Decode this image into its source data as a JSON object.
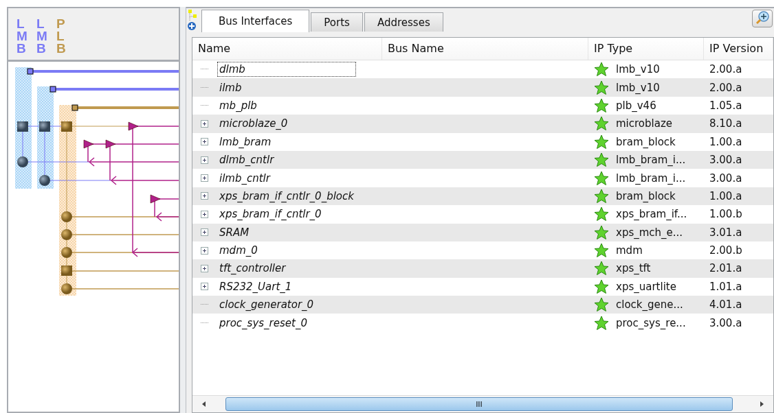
{
  "bus_panel": {
    "buses": [
      {
        "label": "LMB",
        "color": "#7b7bf5"
      },
      {
        "label": "LMB",
        "color": "#7b7bf5"
      },
      {
        "label": "PLB",
        "color": "#c09a50"
      }
    ]
  },
  "tabs": [
    {
      "label": "Bus Interfaces",
      "selected": true
    },
    {
      "label": "Ports",
      "selected": false
    },
    {
      "label": "Addresses",
      "selected": false
    }
  ],
  "table": {
    "columns": [
      "Name",
      "Bus Name",
      "IP Type",
      "IP Version"
    ],
    "rows": [
      {
        "name": "dlmb",
        "expandable": false,
        "focused": true,
        "ip_type": "lmb_v10",
        "ip_version": "2.00.a"
      },
      {
        "name": "ilmb",
        "expandable": false,
        "focused": false,
        "ip_type": "lmb_v10",
        "ip_version": "2.00.a"
      },
      {
        "name": "mb_plb",
        "expandable": false,
        "focused": false,
        "ip_type": "plb_v46",
        "ip_version": "1.05.a"
      },
      {
        "name": "microblaze_0",
        "expandable": true,
        "focused": false,
        "ip_type": "microblaze",
        "ip_version": "8.10.a"
      },
      {
        "name": "lmb_bram",
        "expandable": true,
        "focused": false,
        "ip_type": "bram_block",
        "ip_version": "1.00.a"
      },
      {
        "name": "dlmb_cntlr",
        "expandable": true,
        "focused": false,
        "ip_type": "lmb_bram_i...",
        "ip_version": "3.00.a"
      },
      {
        "name": "ilmb_cntlr",
        "expandable": true,
        "focused": false,
        "ip_type": "lmb_bram_i...",
        "ip_version": "3.00.a"
      },
      {
        "name": "xps_bram_if_cntlr_0_block",
        "expandable": true,
        "focused": false,
        "ip_type": "bram_block",
        "ip_version": "1.00.a"
      },
      {
        "name": "xps_bram_if_cntlr_0",
        "expandable": true,
        "focused": false,
        "ip_type": "xps_bram_if...",
        "ip_version": "1.00.b"
      },
      {
        "name": "SRAM",
        "expandable": true,
        "focused": false,
        "ip_type": "xps_mch_e...",
        "ip_version": "3.01.a"
      },
      {
        "name": "mdm_0",
        "expandable": true,
        "focused": false,
        "ip_type": "mdm",
        "ip_version": "2.00.b"
      },
      {
        "name": "tft_controller",
        "expandable": true,
        "focused": false,
        "ip_type": "xps_tft",
        "ip_version": "2.01.a"
      },
      {
        "name": "RS232_Uart_1",
        "expandable": true,
        "focused": false,
        "ip_type": "xps_uartlite",
        "ip_version": "1.01.a"
      },
      {
        "name": "clock_generator_0",
        "expandable": false,
        "focused": false,
        "ip_type": "clock_gene...",
        "ip_version": "4.01.a"
      },
      {
        "name": "proc_sys_reset_0",
        "expandable": false,
        "focused": false,
        "ip_type": "proc_sys_re...",
        "ip_version": "3.00.a"
      }
    ]
  },
  "scrollbar": {
    "thumb_label": "III"
  }
}
